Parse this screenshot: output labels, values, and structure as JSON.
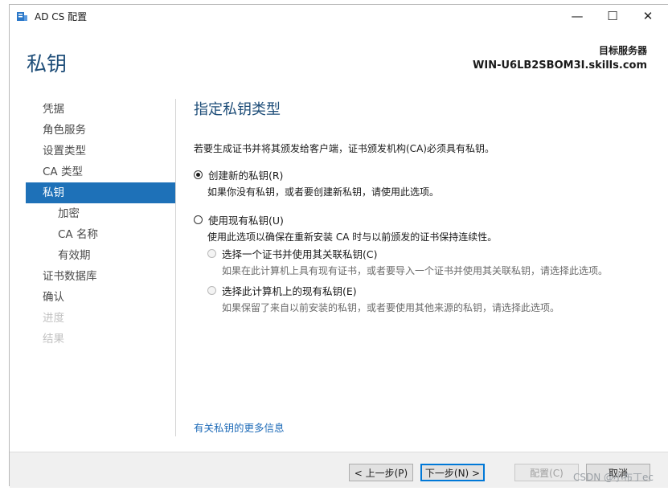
{
  "window": {
    "title": "AD CS 配置",
    "controls": {
      "minimize": "—",
      "maximize": "☐",
      "close": "✕"
    }
  },
  "header": {
    "page_title": "私钥",
    "target_label": "目标服务器",
    "target_value": "WIN-U6LB2SBOM3I.skills.com"
  },
  "sidebar": {
    "items": [
      {
        "label": "凭据",
        "state": "normal"
      },
      {
        "label": "角色服务",
        "state": "normal"
      },
      {
        "label": "设置类型",
        "state": "normal"
      },
      {
        "label": "CA 类型",
        "state": "normal"
      },
      {
        "label": "私钥",
        "state": "active"
      },
      {
        "label": "加密",
        "state": "sub"
      },
      {
        "label": "CA 名称",
        "state": "sub"
      },
      {
        "label": "有效期",
        "state": "sub"
      },
      {
        "label": "证书数据库",
        "state": "normal"
      },
      {
        "label": "确认",
        "state": "normal"
      },
      {
        "label": "进度",
        "state": "disabled"
      },
      {
        "label": "结果",
        "state": "disabled"
      }
    ]
  },
  "main": {
    "section_title": "指定私钥类型",
    "intro": "若要生成证书并将其颁发给客户端，证书颁发机构(CA)必须具有私钥。",
    "options": {
      "create_new": {
        "label": "创建新的私钥(R)",
        "description": "如果你没有私钥，或者要创建新私钥，请使用此选项。",
        "checked": true
      },
      "use_existing": {
        "label": "使用现有私钥(U)",
        "description": "使用此选项以确保在重新安装 CA 时与以前颁发的证书保持连续性。",
        "checked": false
      },
      "select_cert": {
        "label": "选择一个证书并使用其关联私钥(C)",
        "description": "如果在此计算机上具有现有证书，或者要导入一个证书并使用其关联私钥，请选择此选项。",
        "enabled": false
      },
      "select_existing_key": {
        "label": "选择此计算机上的现有私钥(E)",
        "description": "如果保留了来自以前安装的私钥，或者要使用其他来源的私钥，请选择此选项。",
        "enabled": false
      }
    },
    "more_info_link": "有关私钥的更多信息"
  },
  "footer": {
    "prev_label": "< 上一步(P)",
    "next_label": "下一步(N) >",
    "configure_label": "配置(C)",
    "cancel_label": "取消"
  },
  "watermark": "CSDN @小布丁ec",
  "colors": {
    "accent": "#1e71b8",
    "title_blue": "#1f4e79",
    "link": "#1e6bb8"
  }
}
